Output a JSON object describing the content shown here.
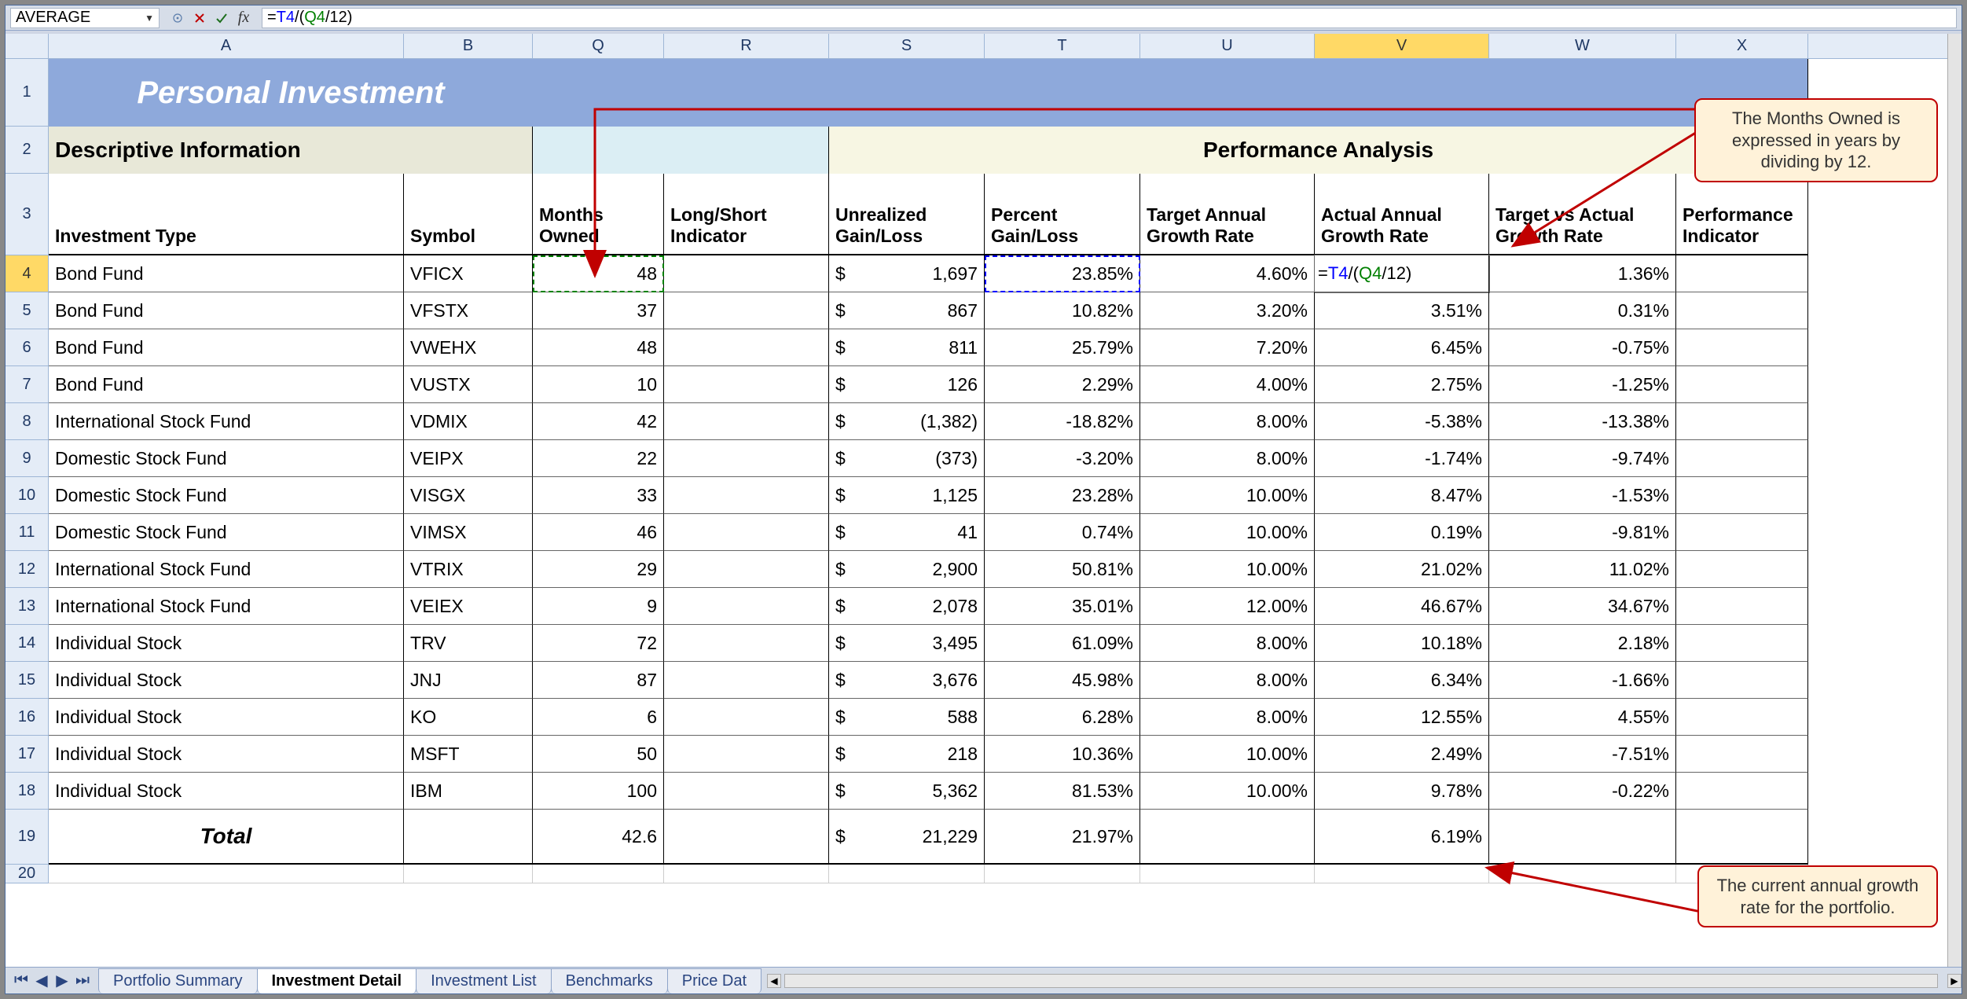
{
  "name_box": "AVERAGE",
  "formula": {
    "raw": "=T4/(Q4/12)",
    "ref1": "T4",
    "ref2": "Q4",
    "tail": "/12)"
  },
  "columns": [
    "A",
    "B",
    "Q",
    "R",
    "S",
    "T",
    "U",
    "V",
    "W",
    "X"
  ],
  "selected_col": "V",
  "selected_row": "4",
  "row_headers": [
    "1",
    "2",
    "3",
    "4",
    "5",
    "6",
    "7",
    "8",
    "9",
    "10",
    "11",
    "12",
    "13",
    "14",
    "15",
    "16",
    "17",
    "18",
    "19",
    "20"
  ],
  "title": "Personal Investment",
  "section_desc": "Descriptive Information",
  "section_perf": "Performance Analysis",
  "headers": {
    "A": "Investment Type",
    "B": "Symbol",
    "Q": "Months Owned",
    "R": "Long/Short Indicator",
    "S": "Unrealized Gain/Loss",
    "T": "Percent Gain/Loss",
    "U": "Target Annual Growth Rate",
    "V": "Actual Annual Growth Rate",
    "W": "Target vs Actual Growth Rate",
    "X": "Performance Indicator"
  },
  "data": [
    {
      "A": "Bond Fund",
      "B": "VFICX",
      "Q": "48",
      "R": "",
      "S": "1,697",
      "T": "23.85%",
      "U": "4.60%",
      "V": "=T4/(Q4/12)",
      "W": "1.36%",
      "X": ""
    },
    {
      "A": "Bond Fund",
      "B": "VFSTX",
      "Q": "37",
      "R": "",
      "S": "867",
      "T": "10.82%",
      "U": "3.20%",
      "V": "3.51%",
      "W": "0.31%",
      "X": ""
    },
    {
      "A": "Bond Fund",
      "B": "VWEHX",
      "Q": "48",
      "R": "",
      "S": "811",
      "T": "25.79%",
      "U": "7.20%",
      "V": "6.45%",
      "W": "-0.75%",
      "X": ""
    },
    {
      "A": "Bond Fund",
      "B": "VUSTX",
      "Q": "10",
      "R": "",
      "S": "126",
      "T": "2.29%",
      "U": "4.00%",
      "V": "2.75%",
      "W": "-1.25%",
      "X": ""
    },
    {
      "A": "International Stock Fund",
      "B": "VDMIX",
      "Q": "42",
      "R": "",
      "S": "(1,382)",
      "T": "-18.82%",
      "U": "8.00%",
      "V": "-5.38%",
      "W": "-13.38%",
      "X": ""
    },
    {
      "A": "Domestic Stock Fund",
      "B": "VEIPX",
      "Q": "22",
      "R": "",
      "S": "(373)",
      "T": "-3.20%",
      "U": "8.00%",
      "V": "-1.74%",
      "W": "-9.74%",
      "X": ""
    },
    {
      "A": "Domestic Stock Fund",
      "B": "VISGX",
      "Q": "33",
      "R": "",
      "S": "1,125",
      "T": "23.28%",
      "U": "10.00%",
      "V": "8.47%",
      "W": "-1.53%",
      "X": ""
    },
    {
      "A": "Domestic Stock Fund",
      "B": "VIMSX",
      "Q": "46",
      "R": "",
      "S": "41",
      "T": "0.74%",
      "U": "10.00%",
      "V": "0.19%",
      "W": "-9.81%",
      "X": ""
    },
    {
      "A": "International Stock Fund",
      "B": "VTRIX",
      "Q": "29",
      "R": "",
      "S": "2,900",
      "T": "50.81%",
      "U": "10.00%",
      "V": "21.02%",
      "W": "11.02%",
      "X": ""
    },
    {
      "A": "International Stock Fund",
      "B": "VEIEX",
      "Q": "9",
      "R": "",
      "S": "2,078",
      "T": "35.01%",
      "U": "12.00%",
      "V": "46.67%",
      "W": "34.67%",
      "X": ""
    },
    {
      "A": "Individual Stock",
      "B": "TRV",
      "Q": "72",
      "R": "",
      "S": "3,495",
      "T": "61.09%",
      "U": "8.00%",
      "V": "10.18%",
      "W": "2.18%",
      "X": ""
    },
    {
      "A": "Individual Stock",
      "B": "JNJ",
      "Q": "87",
      "R": "",
      "S": "3,676",
      "T": "45.98%",
      "U": "8.00%",
      "V": "6.34%",
      "W": "-1.66%",
      "X": ""
    },
    {
      "A": "Individual Stock",
      "B": "KO",
      "Q": "6",
      "R": "",
      "S": "588",
      "T": "6.28%",
      "U": "8.00%",
      "V": "12.55%",
      "W": "4.55%",
      "X": ""
    },
    {
      "A": "Individual Stock",
      "B": "MSFT",
      "Q": "50",
      "R": "",
      "S": "218",
      "T": "10.36%",
      "U": "10.00%",
      "V": "2.49%",
      "W": "-7.51%",
      "X": ""
    },
    {
      "A": "Individual Stock",
      "B": "IBM",
      "Q": "100",
      "R": "",
      "S": "5,362",
      "T": "81.53%",
      "U": "10.00%",
      "V": "9.78%",
      "W": "-0.22%",
      "X": ""
    }
  ],
  "total": {
    "label": "Total",
    "Q": "42.6",
    "S": "21,229",
    "T": "21.97%",
    "V": "6.19%"
  },
  "currency_symbol": "$",
  "tabs": [
    "Portfolio Summary",
    "Investment Detail",
    "Investment List",
    "Benchmarks",
    "Price Dat"
  ],
  "active_tab": "Investment Detail",
  "callout_top": "The Months Owned is expressed in years by dividing by 12.",
  "callout_bot": "The current annual growth rate for the portfolio."
}
